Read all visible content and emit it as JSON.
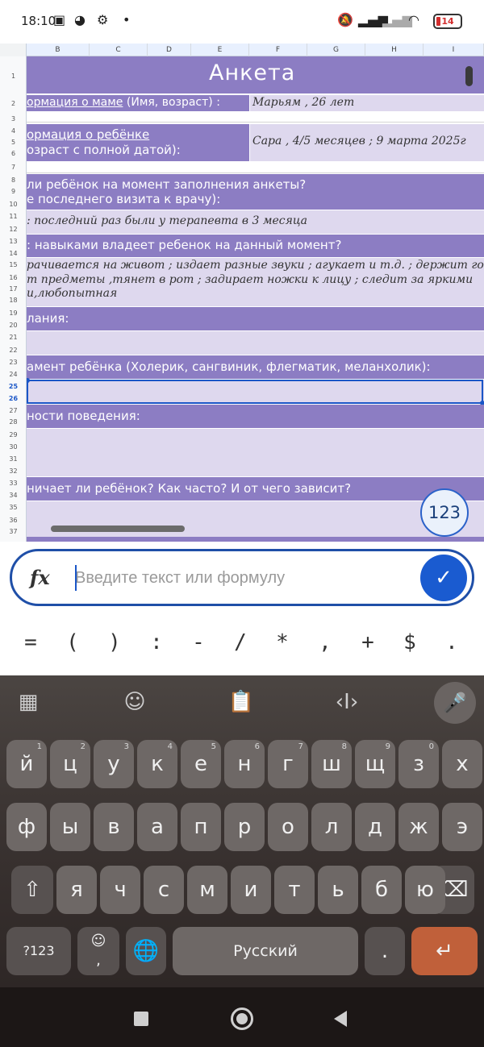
{
  "status_bar": {
    "time": "18:10",
    "icons": [
      "notification-icon",
      "whatsapp-icon",
      "settings-gear-icon",
      "dot-icon",
      "bell-muted-icon",
      "signal-icon",
      "signal-weak-icon",
      "wifi-icon"
    ],
    "battery": "14"
  },
  "sheet": {
    "columns": [
      "B",
      "C",
      "D",
      "E",
      "F",
      "G",
      "H",
      "I"
    ],
    "rows": [
      "1",
      "2",
      "3",
      "4",
      "5",
      "6",
      "7",
      "8",
      "9",
      "10",
      "11",
      "12",
      "13",
      "14",
      "15",
      "16",
      "17",
      "18",
      "19",
      "20",
      "21",
      "22",
      "23",
      "24",
      "25",
      "26",
      "27",
      "28",
      "29",
      "30",
      "31",
      "32",
      "33",
      "34",
      "35",
      "36",
      "37"
    ],
    "selected_rows": [
      "25",
      "26"
    ],
    "title": "Анкета",
    "mother_label_1": "ормация о маме",
    "mother_label_2": " (Имя, возраст) :",
    "mother_value": "Марьям , 26 лет",
    "child_label_1": "ормация о ребёнке",
    "child_label_2": "озраст с полной датой):",
    "child_value": "Сара , 4/5 месяцев ; 9 марта 2025г",
    "q_health_1": "ли ребёнок на момент заполнения анкеты?",
    "q_health_2": "е последнего визита к врачу):",
    "a_health": ": последний раз были у терапевта в 3 месяца",
    "q_skills": ": навыками владеет ребенок на данный момент?",
    "a_skills_1": "рачивается на живот ; издает разные звуки ; агукает и т.д. ; держит го",
    "a_skills_2": "т предметы ,тянет в рот ; задирает ножки к лицу ; следит за яркими",
    "a_skills_3": "и,любопытная",
    "q_diseases": "лания:",
    "q_temperament": "амент ребёнка (Холерик, сангвиник, флегматик, меланхолик):",
    "q_behavior": "ности поведения:",
    "q_crying": "ничает ли ребёнок? Как часто? И от чего зависит?",
    "fab_label": "123"
  },
  "formula_bar": {
    "fx_label": "fx",
    "placeholder": "Введите текст или формулу",
    "value": ""
  },
  "symbols": [
    "=",
    "(",
    ")",
    ":",
    "-",
    "/",
    "*",
    ",",
    "+",
    "$",
    "."
  ],
  "keyboard": {
    "tools": [
      "apps-grid-icon",
      "sticker-icon",
      "clipboard-icon",
      "cursor-move-icon",
      "mic-icon"
    ],
    "row1": [
      {
        "k": "й",
        "h": "1"
      },
      {
        "k": "ц",
        "h": "2"
      },
      {
        "k": "у",
        "h": "3"
      },
      {
        "k": "к",
        "h": "4"
      },
      {
        "k": "е",
        "h": "5"
      },
      {
        "k": "н",
        "h": "6"
      },
      {
        "k": "г",
        "h": "7"
      },
      {
        "k": "ш",
        "h": "8"
      },
      {
        "k": "щ",
        "h": "9"
      },
      {
        "k": "з",
        "h": "0"
      },
      {
        "k": "х",
        "h": ""
      }
    ],
    "row2": [
      "ф",
      "ы",
      "в",
      "а",
      "п",
      "р",
      "о",
      "л",
      "д",
      "ж",
      "э"
    ],
    "row3": [
      "я",
      "ч",
      "с",
      "м",
      "и",
      "т",
      "ь",
      "б",
      "ю"
    ],
    "numbers_key": "?123",
    "emoji_key": "☺",
    "comma": ",",
    "space_label": "Русский",
    "period": "."
  }
}
